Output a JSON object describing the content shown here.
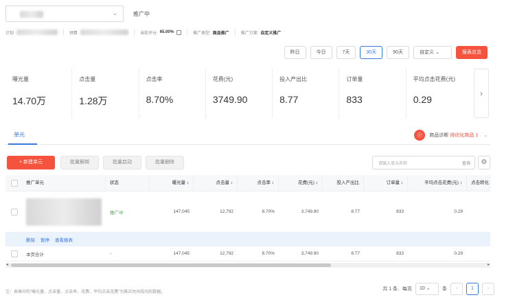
{
  "top": {
    "status": "推广中"
  },
  "info": {
    "plan_label": "计划",
    "budget_label": "预算",
    "score_label": "当前评分:",
    "score_value": "65.00%",
    "type_label": "推广类型:",
    "type_value": "商品推广",
    "method_label": "推广方案:",
    "method_value": "自定义推广"
  },
  "date_buttons": [
    "昨日",
    "今日",
    "7天",
    "30天",
    "90天"
  ],
  "date_custom": "自定义",
  "report_button": "报表总览",
  "metrics": [
    {
      "label": "曝光量",
      "value": "14.70万"
    },
    {
      "label": "点击量",
      "value": "1.28万"
    },
    {
      "label": "点击率",
      "value": "8.70%"
    },
    {
      "label": "花费(元)",
      "value": "3749.90"
    },
    {
      "label": "投入产出比",
      "value": "8.77"
    },
    {
      "label": "订单量",
      "value": "833"
    },
    {
      "label": "平均点击花费(元)",
      "value": "0.29"
    }
  ],
  "tab": "单元",
  "diagnosis": {
    "text": "商品诊断",
    "highlight": "待优化商品 1"
  },
  "toolbar": {
    "new_unit": "+ 新建单元",
    "batch_unbind": "批量解绑",
    "batch_start": "批量启动",
    "batch_delete": "批量删除",
    "search_placeholder": "请输入单元名称",
    "search_button": "查询"
  },
  "table": {
    "headers": [
      "推广单元",
      "状态",
      "曝光量 ↕",
      "点击量 ↕",
      "点击率 ↕",
      "花费(元) ↕",
      "投入产出比",
      "订单量 ↕",
      "平均点击花费(元) ↕",
      "点击转化"
    ],
    "row": {
      "status": "推广中",
      "impressions": "147,045",
      "clicks": "12,792",
      "ctr": "8.70%",
      "cost": "3,749.90",
      "roi": "8.77",
      "orders": "833",
      "cpc": "0.29"
    },
    "actions": [
      "删除",
      "暂停",
      "查看报表"
    ],
    "total": {
      "label": "本页合计",
      "status": "-",
      "impressions": "147,045",
      "clicks": "12,792",
      "ctr": "8.70%",
      "cost": "3,749.90",
      "roi": "8.77",
      "orders": "833",
      "cpc": "0.29"
    }
  },
  "footer": {
    "note": "注：表格中的\"曝光量、点击量、点击率、花费、平均点击花费\"为推正时间段内的数据。",
    "total_count": "共 1 条,",
    "per_page_label": "每页",
    "per_page": "10",
    "per_page_unit": "条",
    "current_page": "1"
  }
}
